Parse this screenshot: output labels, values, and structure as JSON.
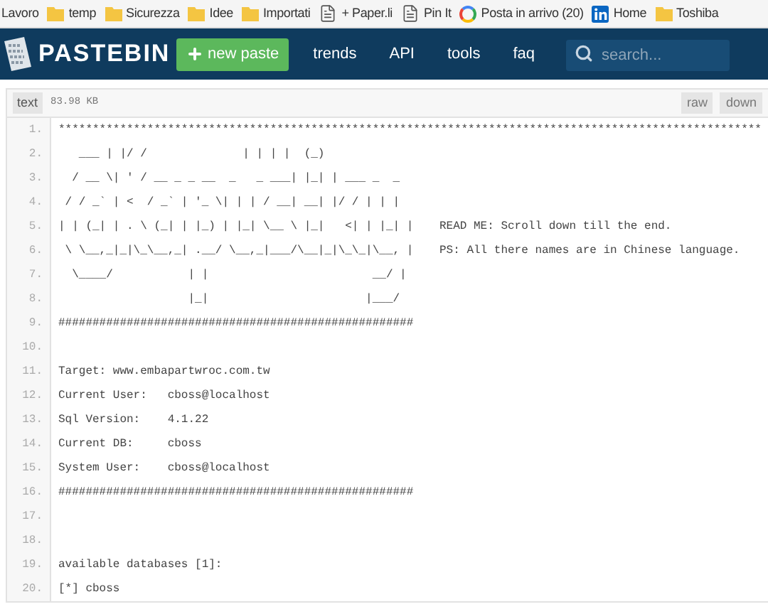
{
  "bookmarks": [
    {
      "label": "Lavoro",
      "kind": "none"
    },
    {
      "label": "temp",
      "kind": "folder"
    },
    {
      "label": "Sicurezza",
      "kind": "folder"
    },
    {
      "label": "Idee",
      "kind": "folder"
    },
    {
      "label": "Importati",
      "kind": "folder"
    },
    {
      "label": "+ Paper.li",
      "kind": "page"
    },
    {
      "label": "Pin It",
      "kind": "page"
    },
    {
      "label": "Posta in arrivo (20)",
      "kind": "google"
    },
    {
      "label": "Home",
      "kind": "linkedin"
    },
    {
      "label": "Toshiba",
      "kind": "folder"
    }
  ],
  "header": {
    "logo": "PASTEBIN",
    "new_paste": "new paste",
    "nav": [
      "trends",
      "API",
      "tools",
      "faq"
    ],
    "search": {
      "placeholder": "search..."
    }
  },
  "paste": {
    "format": "text",
    "size": "83.98 KB",
    "actions": [
      "raw",
      "down"
    ],
    "lines": [
      {
        "number": "1.",
        "code": "*******************************************************************************************************"
      },
      {
        "number": "2.",
        "code": "   ___ | |/ /              | | | |  (_)"
      },
      {
        "number": "3.",
        "code": "  / __ \\| ' / __ _ _ __  _   _ ___| |_| | ___ _  _"
      },
      {
        "number": "4.",
        "code": " / / _` | <  / _` | '_ \\| | | / __| __| |/ / | | |"
      },
      {
        "number": "5.",
        "code": "| | (_| | . \\ (_| | |_) | |_| \\__ \\ |_|   <| | |_| |",
        "note": "READ ME: Scroll down till the end."
      },
      {
        "number": "6.",
        "code": " \\ \\__,_|_|\\_\\__,_| .__/ \\__,_|___/\\__|_|\\_\\_|\\__, |",
        "note": "PS: All there names are in Chinese language."
      },
      {
        "number": "7.",
        "code": "  \\____/           | |                        __/ |"
      },
      {
        "number": "8.",
        "code": "                   |_|                       |___/"
      },
      {
        "number": "9.",
        "code": "####################################################"
      },
      {
        "number": "10."
      },
      {
        "number": "11.",
        "code": "Target: www.embapartwroc.com.tw"
      },
      {
        "number": "12.",
        "code": "Current User:   cboss@localhost"
      },
      {
        "number": "13.",
        "code": "Sql Version:    4.1.22"
      },
      {
        "number": "14.",
        "code": "Current DB:     cboss"
      },
      {
        "number": "15.",
        "code": "System User:    cboss@localhost"
      },
      {
        "number": "16.",
        "code": "####################################################"
      },
      {
        "number": "17."
      },
      {
        "number": "18."
      },
      {
        "number": "19.",
        "code": "available databases [1]:"
      },
      {
        "number": "20.",
        "code": "[*] cboss"
      }
    ]
  }
}
